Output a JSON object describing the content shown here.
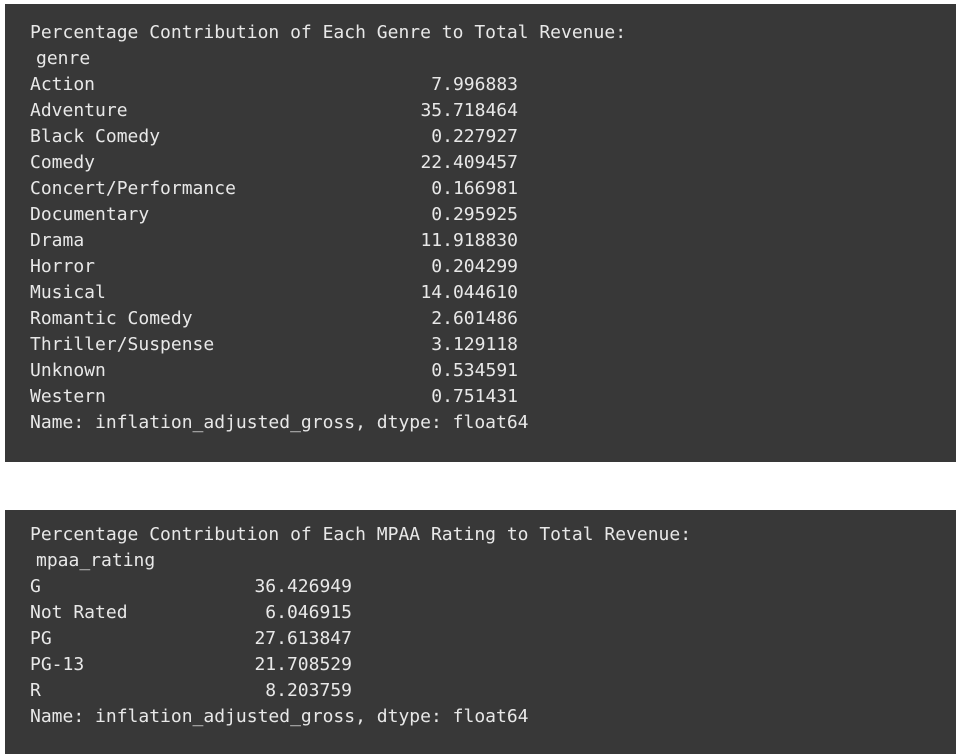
{
  "genre_output": {
    "heading": "Percentage Contribution of Each Genre to Total Revenue:",
    "index_name": "genre",
    "rows": [
      {
        "label": "Action",
        "value": "7.996883"
      },
      {
        "label": "Adventure",
        "value": "35.718464"
      },
      {
        "label": "Black Comedy",
        "value": "0.227927"
      },
      {
        "label": "Comedy",
        "value": "22.409457"
      },
      {
        "label": "Concert/Performance",
        "value": "0.166981"
      },
      {
        "label": "Documentary",
        "value": "0.295925"
      },
      {
        "label": "Drama",
        "value": "11.918830"
      },
      {
        "label": "Horror",
        "value": "0.204299"
      },
      {
        "label": "Musical",
        "value": "14.044610"
      },
      {
        "label": "Romantic Comedy",
        "value": "2.601486"
      },
      {
        "label": "Thriller/Suspense",
        "value": "3.129118"
      },
      {
        "label": "Unknown",
        "value": "0.534591"
      },
      {
        "label": "Western",
        "value": "0.751431"
      }
    ],
    "footer": "Name: inflation_adjusted_gross, dtype: float64"
  },
  "rating_output": {
    "heading": "Percentage Contribution of Each MPAA Rating to Total Revenue:",
    "index_name": "mpaa_rating",
    "rows": [
      {
        "label": "G",
        "value": "36.426949"
      },
      {
        "label": "Not Rated",
        "value": "6.046915"
      },
      {
        "label": "PG",
        "value": "27.613847"
      },
      {
        "label": "PG-13",
        "value": "21.708529"
      },
      {
        "label": "R",
        "value": "8.203759"
      }
    ],
    "footer": "Name: inflation_adjusted_gross, dtype: float64"
  },
  "colors": {
    "panel_background": "#383838",
    "text": "#e8e8e8",
    "page_background": "#ffffff"
  }
}
